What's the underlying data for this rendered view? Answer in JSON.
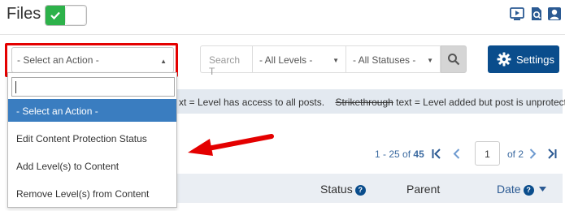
{
  "header": {
    "title": "Files",
    "toggle_state": "on",
    "icons": [
      "video-tutorial-icon",
      "search-document-icon",
      "user-icon"
    ]
  },
  "toolbar": {
    "action_select": {
      "value": "- Select an Action -",
      "options": [
        "- Select an Action -",
        "Edit Content Protection Status",
        "Add Level(s) to Content",
        "Remove Level(s) from Content"
      ],
      "search_value": ""
    },
    "search": {
      "placeholder": "Search T"
    },
    "levels_select": {
      "value": "- All Levels -"
    },
    "statuses_select": {
      "value": "- All Statuses -"
    },
    "settings_label": "Settings"
  },
  "notice": {
    "partial_text": "xt = Level has access to all posts.",
    "strike_word": "Strikethrough",
    "rest_text": " text = Level added but post is unprotected."
  },
  "pagination": {
    "range": "1 - 25",
    "of_word": "of",
    "total": "45",
    "current_page": "1",
    "of_pages": "of 2"
  },
  "table": {
    "columns": [
      {
        "label": "Status",
        "help": "?"
      },
      {
        "label": "Parent"
      },
      {
        "label": "Date",
        "help": "?",
        "sort": "descending"
      }
    ]
  },
  "colors": {
    "accent": "#0a4d8c",
    "toggle_on": "#2db24a",
    "highlight_box": "#e40000",
    "selected_option": "#3a7dc0"
  }
}
